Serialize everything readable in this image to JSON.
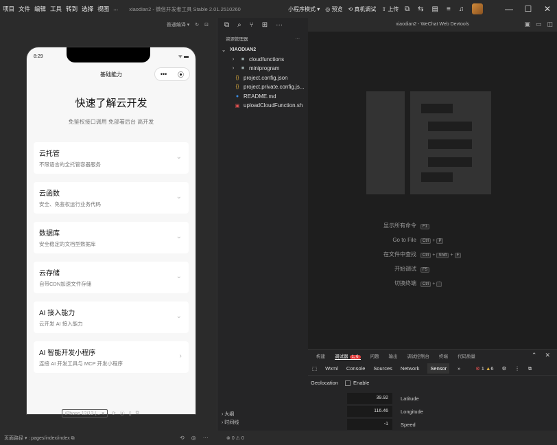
{
  "menu": [
    "项目",
    "文件",
    "编辑",
    "工具",
    "转到",
    "选择",
    "视图",
    "..."
  ],
  "window_title": "xiaodian2 - 微信开发者工具 Stable 2.01.2510260",
  "toolbar": {
    "mode": "小程序模式",
    "preview": "预览",
    "real_debug": "真机调试",
    "upload": "上传"
  },
  "simulator": {
    "compile_mode": "普通编译",
    "time": "8:29",
    "nav_title": "基础能力",
    "hero_title": "快速了解云开发",
    "hero_sub": "免鉴权接口调用 免部署后台 高开发",
    "cards": [
      {
        "title": "云托管",
        "desc": "不限语言的全托管容器服务"
      },
      {
        "title": "云函数",
        "desc": "安全、免鉴权运行业务代码"
      },
      {
        "title": "数据库",
        "desc": "安全稳定的文档型数据库"
      },
      {
        "title": "云存储",
        "desc": "自带CDN加速文件存储"
      },
      {
        "title": "AI 接入能力",
        "desc": "云开发 AI 接入能力"
      },
      {
        "title": "AI 智能开发小程序",
        "desc": "连接 AI 开发工具与 MCP 开发小程序"
      }
    ],
    "device": "iPhone 12/13 (..."
  },
  "explorer": {
    "header": "资源管理器",
    "root": "XIAODIAN2",
    "items": [
      {
        "name": "cloudfunctions",
        "icon": "folder"
      },
      {
        "name": "miniprogram",
        "icon": "folder"
      }
    ],
    "files": [
      {
        "name": "project.config.json",
        "icon": "{-}"
      },
      {
        "name": "project.private.config.js...",
        "icon": "{-}"
      },
      {
        "name": "README.md",
        "icon": "i"
      },
      {
        "name": "uploadCloudFunction.sh",
        "icon": "sh"
      }
    ],
    "outline": "大纲",
    "timeline": "时间线"
  },
  "devtools": {
    "title": "xiaodian2 - WeChat Web Devtools",
    "commands": [
      {
        "label": "显示所有命令",
        "keys": [
          "F1"
        ]
      },
      {
        "label": "Go to File",
        "keys": [
          "Ctrl",
          "P"
        ]
      },
      {
        "label": "在文件中查找",
        "keys": [
          "Ctrl",
          "Shift",
          "F"
        ]
      },
      {
        "label": "开始调试",
        "keys": [
          "F5"
        ]
      },
      {
        "label": "切换终端",
        "keys": [
          "Ctrl",
          "`"
        ]
      }
    ],
    "tabs": [
      "构建",
      "调试器",
      "问题",
      "输出",
      "调试控制台",
      "终端",
      "代码质量"
    ],
    "badge": "1, 6",
    "subtabs": [
      "Wxml",
      "Console",
      "Sources",
      "Network",
      "Sensor"
    ],
    "errors": "1",
    "warnings": "6",
    "geolocation": "Geolocation",
    "enable": "Enable",
    "geo_rows": [
      {
        "value": "39.92",
        "label": "Latitude"
      },
      {
        "value": "116.46",
        "label": "Longitude"
      },
      {
        "value": "-1",
        "label": "Speed"
      }
    ]
  },
  "statusbar": {
    "path_label": "页面路径",
    "path": "pages/index/index",
    "errors": "0",
    "warnings": "0"
  }
}
